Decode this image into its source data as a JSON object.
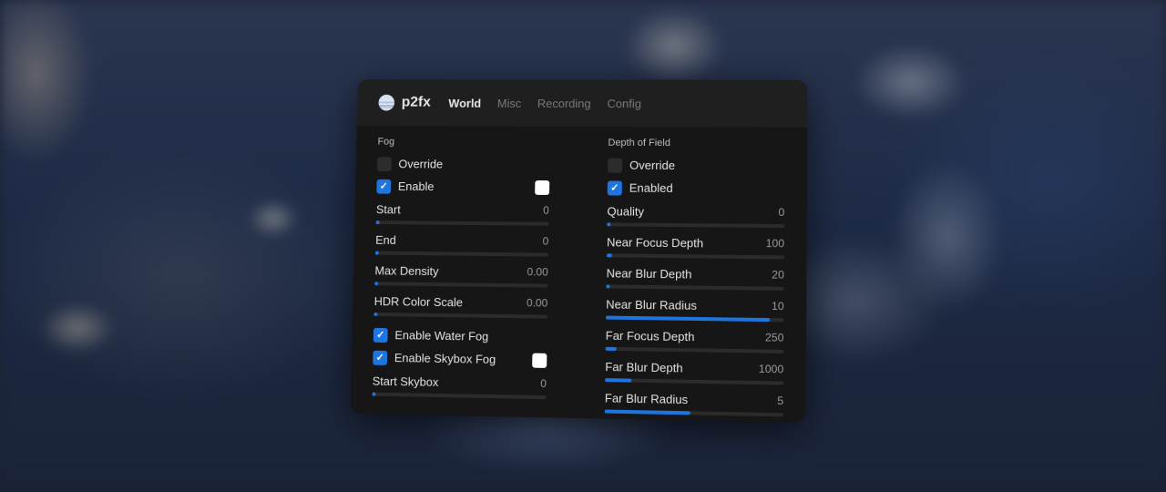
{
  "header": {
    "brand": "p2fx",
    "tabs": [
      {
        "label": "World",
        "active": true
      },
      {
        "label": "Misc",
        "active": false
      },
      {
        "label": "Recording",
        "active": false
      },
      {
        "label": "Config",
        "active": false
      }
    ]
  },
  "fog": {
    "title": "Fog",
    "override": {
      "label": "Override",
      "checked": false
    },
    "enable": {
      "label": "Enable",
      "checked": true,
      "color": "#ffffff"
    },
    "start": {
      "label": "Start",
      "value": "0",
      "fraction": 0.0
    },
    "end": {
      "label": "End",
      "value": "0",
      "fraction": 0.0
    },
    "max_density": {
      "label": "Max Density",
      "value": "0.00",
      "fraction": 0.0
    },
    "hdr_color_scale": {
      "label": "HDR Color Scale",
      "value": "0.00",
      "fraction": 0.0
    },
    "enable_water_fog": {
      "label": "Enable Water Fog",
      "checked": true
    },
    "enable_skybox_fog": {
      "label": "Enable Skybox Fog",
      "checked": true,
      "color": "#ffffff"
    },
    "start_skybox": {
      "label": "Start Skybox",
      "value": "0",
      "fraction": 0.0
    }
  },
  "dof": {
    "title": "Depth of Field",
    "override": {
      "label": "Override",
      "checked": false
    },
    "enabled": {
      "label": "Enabled",
      "checked": true
    },
    "quality": {
      "label": "Quality",
      "value": "0",
      "fraction": 0.0
    },
    "near_focus_depth": {
      "label": "Near Focus Depth",
      "value": "100",
      "fraction": 0.03
    },
    "near_blur_depth": {
      "label": "Near Blur Depth",
      "value": "20",
      "fraction": 0.02
    },
    "near_blur_radius": {
      "label": "Near Blur Radius",
      "value": "10",
      "fraction": 0.92
    },
    "far_focus_depth": {
      "label": "Far Focus Depth",
      "value": "250",
      "fraction": 0.06
    },
    "far_blur_depth": {
      "label": "Far Blur Depth",
      "value": "1000",
      "fraction": 0.15
    },
    "far_blur_radius": {
      "label": "Far Blur Radius",
      "value": "5",
      "fraction": 0.48
    }
  },
  "colors": {
    "accent": "#1e75e0",
    "panel": "#161616",
    "track": "#2b2b2b"
  }
}
